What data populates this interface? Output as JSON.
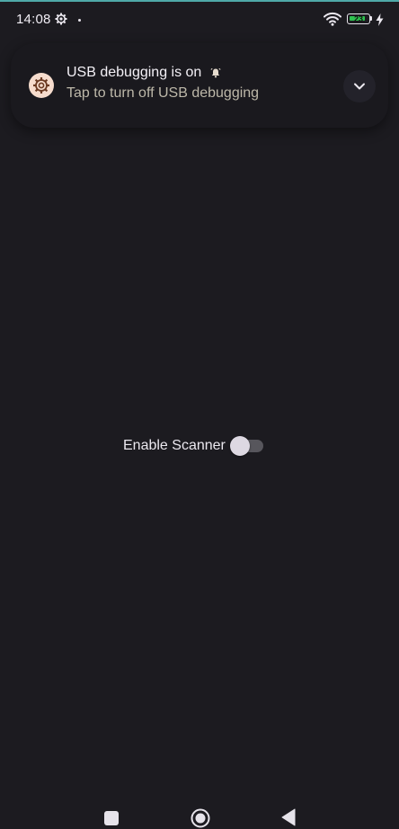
{
  "status_bar": {
    "time": "14:08",
    "battery_level": "23",
    "icons": [
      "settings-gear-icon",
      "notification-dot",
      "wifi-icon",
      "battery-icon",
      "charging-bolt-icon"
    ]
  },
  "notification": {
    "app_icon": "debug-settings-icon",
    "title": "USB debugging is on",
    "title_badge_icon": "alarm-bell-icon",
    "text": "Tap to turn off USB debugging",
    "expand_icon": "chevron-down-icon"
  },
  "main": {
    "scanner_toggle": {
      "label": "Enable Scanner",
      "checked": false
    }
  },
  "nav_bar": {
    "buttons": [
      "recents-button",
      "home-button",
      "back-button"
    ]
  },
  "colors": {
    "background": "#1c1b20",
    "accent_line": "#4fa9a8",
    "battery_green": "#2ec24f",
    "notification_icon_bg": "#f6dccd",
    "switch_track_off": "#57565c"
  }
}
